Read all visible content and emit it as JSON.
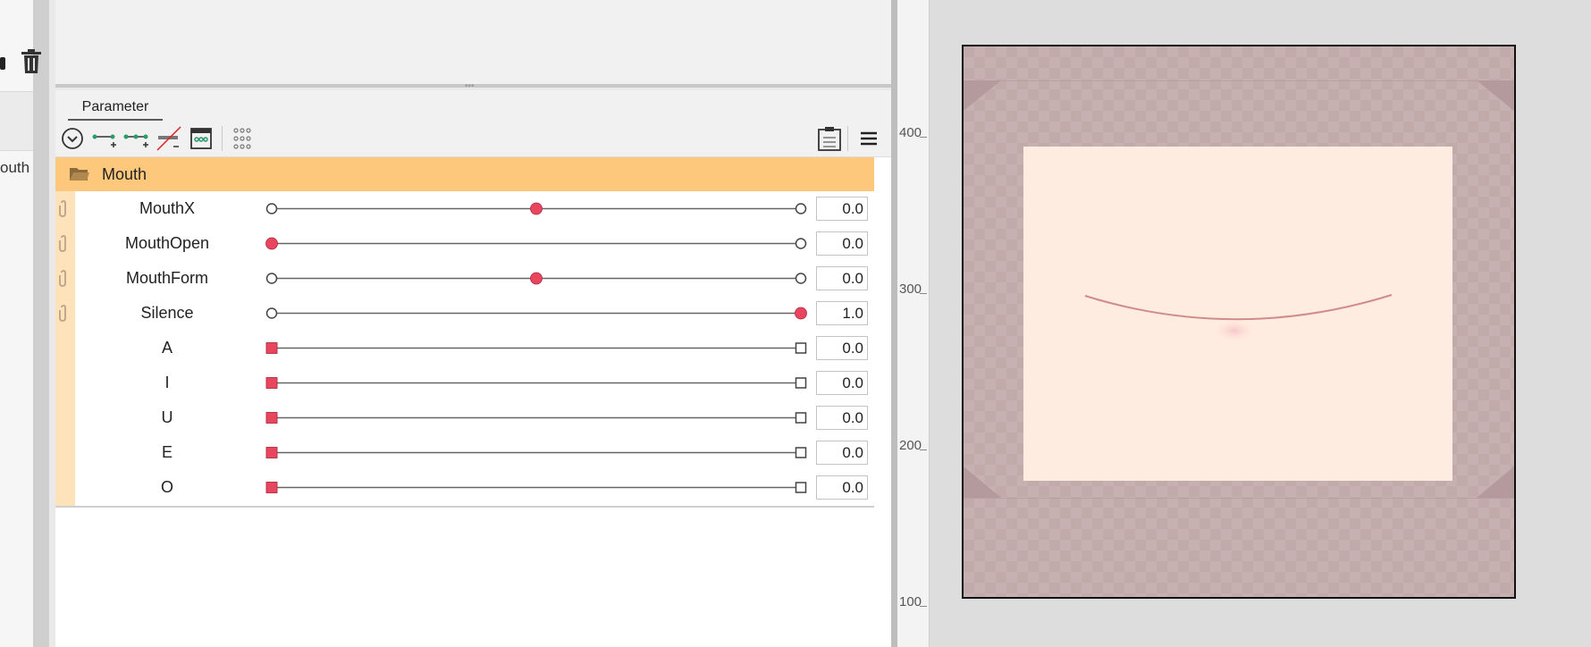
{
  "left_panel": {
    "partial_label": "outh"
  },
  "parameter_panel": {
    "tab_label": "Parameter",
    "group": {
      "name": "Mouth"
    },
    "parameters": [
      {
        "name": "MouthX",
        "value": "0.0",
        "handle": "circle",
        "position": 0.5
      },
      {
        "name": "MouthOpen",
        "value": "0.0",
        "handle": "circle",
        "position": 0.0
      },
      {
        "name": "MouthForm",
        "value": "0.0",
        "handle": "circle",
        "position": 0.5
      },
      {
        "name": "Silence",
        "value": "1.0",
        "handle": "circle",
        "position": 1.0
      },
      {
        "name": "A",
        "value": "0.0",
        "handle": "square",
        "position": 0.0
      },
      {
        "name": "I",
        "value": "0.0",
        "handle": "square",
        "position": 0.0
      },
      {
        "name": "U",
        "value": "0.0",
        "handle": "square",
        "position": 0.0
      },
      {
        "name": "E",
        "value": "0.0",
        "handle": "square",
        "position": 0.0
      },
      {
        "name": "O",
        "value": "0.0",
        "handle": "square",
        "position": 0.0
      }
    ],
    "toolbar_icons": [
      "collapse-icon",
      "add-param-icon",
      "add-keys-icon",
      "remove-param-icon",
      "keyform-icon",
      "grid-dots-icon",
      "paste-icon",
      "menu-icon"
    ]
  },
  "ruler": {
    "labels": [
      "400",
      "300",
      "200",
      "100"
    ]
  },
  "colors": {
    "group_bg": "#fec87c",
    "accent_handle": "#e8455f",
    "canvas_bg": "#c7b0b1",
    "face": "#ffece1",
    "mouth_line": "#d08c8c"
  }
}
